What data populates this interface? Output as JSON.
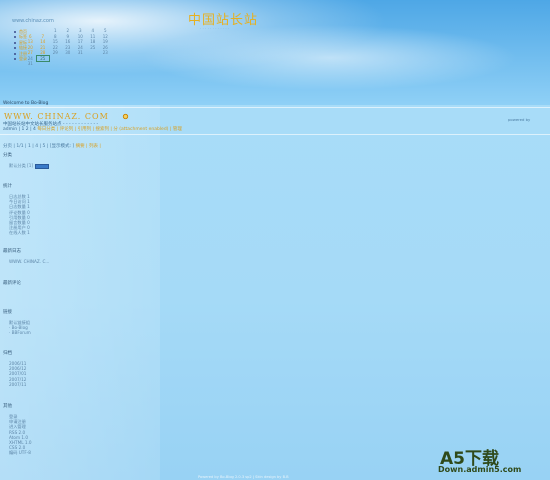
{
  "header": {
    "site_title": "中国站长站",
    "site_subtitle": "· · · · · · · · · · · ·",
    "url_text": "www.chinaz.com",
    "welcome": "Welcome to Bo-Blog"
  },
  "side_menu": [
    "首页",
    "标签",
    "星标",
    "链接",
    "注册",
    "登录"
  ],
  "calendar": {
    "rows": [
      [
        "",
        "",
        "1",
        "2",
        "3",
        "4",
        "5"
      ],
      [
        "6",
        "7",
        "8",
        "9",
        "10",
        "11",
        "12"
      ],
      [
        "13",
        "14",
        "15",
        "16",
        "17",
        "18",
        "19"
      ],
      [
        "20",
        "21",
        "22",
        "23",
        "24",
        "25",
        "26"
      ],
      [
        "27",
        "28",
        "29",
        "30",
        "31",
        "",
        "23"
      ],
      [
        "24",
        "25",
        "",
        "",
        "",
        "",
        ""
      ],
      [
        "31",
        "",
        "",
        "",
        "",
        "",
        ""
      ]
    ],
    "selected": "25"
  },
  "blog": {
    "name": "WWW. CHINAZ. COM",
    "description": "中国站长站中文站长服务站点 - - - - - - - - - - - -",
    "nav_prefix": "admin | 1 2 | 4 ",
    "nav_links": "每日分类 | 评论列 | 引用列 | 搜索列 | 分 (attachment enabled) | 管理",
    "right_text": "powered by",
    "pager_prefix": "分页 | 1/1 | 1 | 4 | 5 | [显示模式: ]",
    "pager_modes": "摘要 | 列表 |"
  },
  "sections": [
    {
      "title": "分类",
      "items": [
        "默认分类 [1]"
      ]
    },
    {
      "title": "统计",
      "items": [
        "日志总数 1",
        "今日访问 1",
        "日志数量 1",
        "评论数量 0",
        "引用数量 0",
        "留言数量 0",
        "注册用户 0",
        "在线人数 1"
      ]
    },
    {
      "title": "最新日志",
      "items": [
        "WWW. CHINAZ. C..."
      ]
    },
    {
      "title": "最新评论",
      "items": []
    },
    {
      "title": "链接",
      "items": [
        "默认链接组",
        "· Bo-Blog",
        "· BBForum"
      ]
    },
    {
      "title": "归档",
      "items": [
        "2006/11",
        "2006/12",
        "2007/01",
        "2007/12",
        "2007/11"
      ]
    },
    {
      "title": "其他",
      "items": [
        "登录",
        "申请注册",
        "进入管理",
        "RSS 2.0",
        "Atom 1.0",
        "XHTML 1.0",
        "CSS 2.0",
        "编码 UTF-8"
      ]
    }
  ],
  "footer": "Powered by Bo-Blog 2.0.3 sp2 | Skin design by B.B",
  "watermark": {
    "logo": "A5下载",
    "sub": "Down.admin5.com"
  }
}
